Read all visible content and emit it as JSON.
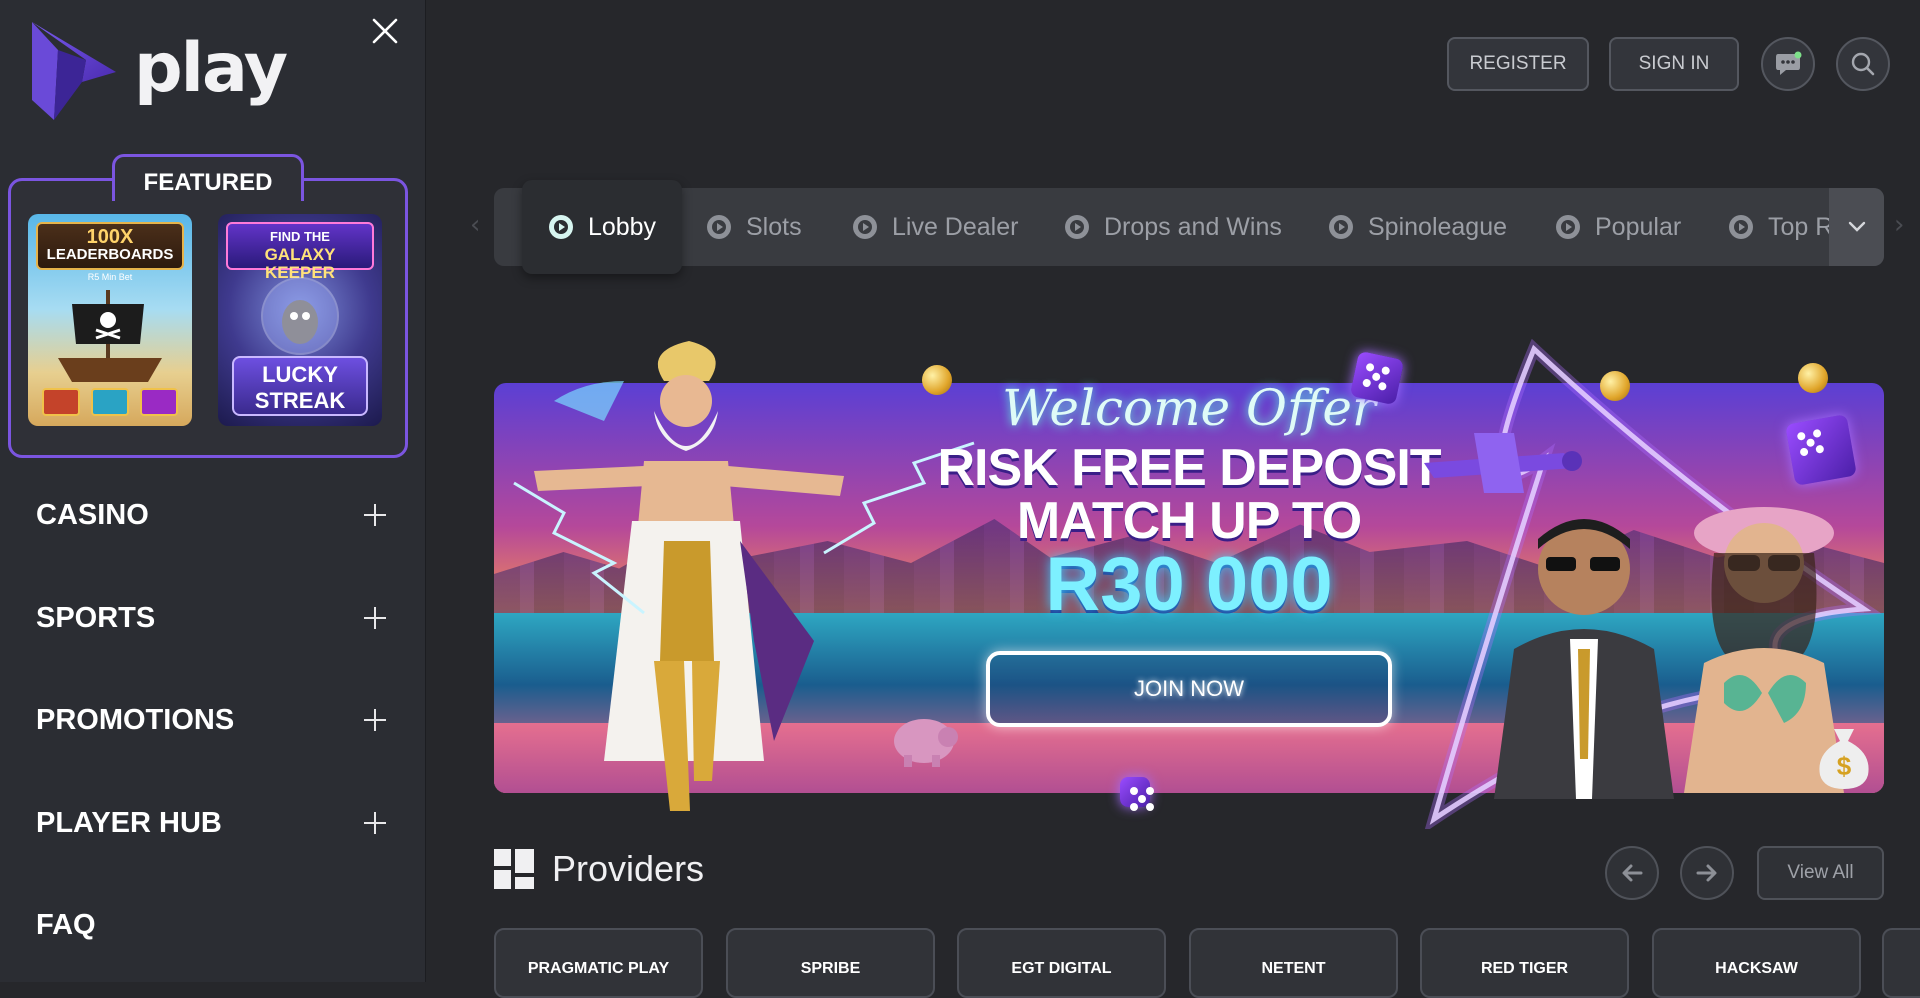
{
  "brand": {
    "name": "play"
  },
  "sidebar": {
    "featured_label": "FEATURED",
    "featured_cards": [
      {
        "top": "100X",
        "sub": "LEADERBOARDS",
        "note": "R5 Min Bet"
      },
      {
        "top": "FIND THE",
        "sub": "GALAXY KEEPER",
        "bottom": "LUCKY STREAK"
      }
    ],
    "nav": [
      {
        "label": "CASINO",
        "expandable": true
      },
      {
        "label": "SPORTS",
        "expandable": true
      },
      {
        "label": "PROMOTIONS",
        "expandable": true
      },
      {
        "label": "PLAYER HUB",
        "expandable": true
      },
      {
        "label": "FAQ",
        "expandable": false
      }
    ]
  },
  "header": {
    "register": "REGISTER",
    "sign_in": "SIGN IN",
    "icons": [
      "chat-icon",
      "search-icon"
    ]
  },
  "tabs": [
    {
      "label": "Lobby",
      "active": true
    },
    {
      "label": "Slots"
    },
    {
      "label": "Live Dealer"
    },
    {
      "label": "Drops and Wins"
    },
    {
      "label": "Spinoleague"
    },
    {
      "label": "Popular"
    },
    {
      "label": "Top R"
    }
  ],
  "hero": {
    "script": "Welcome Offer",
    "line1": "RISK FREE DEPOSIT",
    "line2": "MATCH UP TO",
    "amount": "R30 000",
    "cta": "JOIN NOW"
  },
  "providers": {
    "title": "Providers",
    "view_all": "View All",
    "items": [
      "PRAGMATIC PLAY",
      "SPRIBE",
      "EGT DIGITAL",
      "NETENT",
      "RED TIGER",
      "HACKSAW"
    ]
  },
  "colors": {
    "background": "#26272b",
    "sidebar": "#2b2d33",
    "accent_purple": "#7b55e0",
    "text": "#ffffff"
  }
}
